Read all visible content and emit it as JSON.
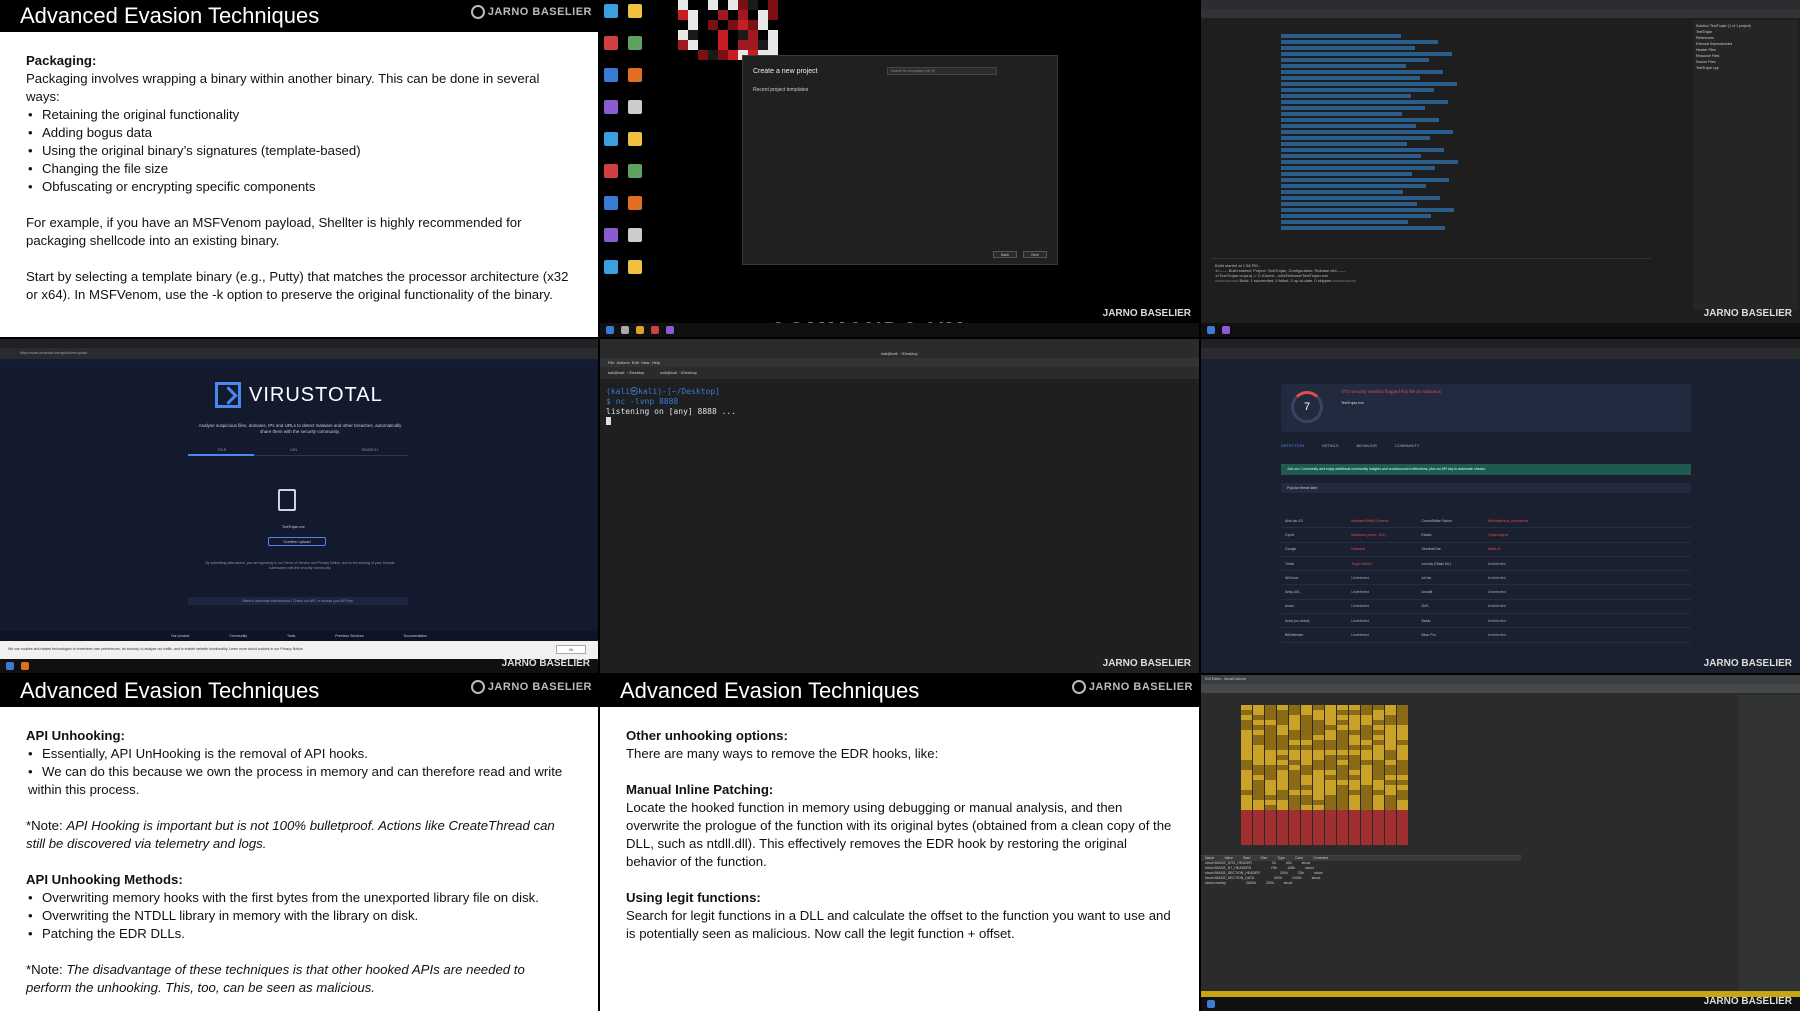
{
  "slides": {
    "packaging": {
      "title": "Advanced Evasion Techniques",
      "brand": "JARNO BASELIER",
      "heading": "Packaging:",
      "intro": "Packaging involves wrapping a binary within another binary. This can be done in several ways:",
      "bullets": [
        "Retaining the original functionality",
        "Adding bogus data",
        "Using the original binary’s signatures (template-based)",
        "Changing the file size",
        "Obfuscating or encrypting specific components"
      ],
      "para1": "For example, if you have an MSFVenom payload, Shellter is highly recommended for packaging shellcode into an existing binary.",
      "para2": "Start by selecting a template binary (e.g., Putty) that matches the processor architecture (x32 or x64). In MSFVenom, use the -k option to preserve the original functionality of the binary."
    },
    "api_unhooking": {
      "title": "Advanced Evasion Techniques",
      "brand": "JARNO BASELIER",
      "heading": "API Unhooking:",
      "bullets": [
        "Essentially, API UnHooking is the removal of API hooks.",
        "We can do this because we own the process in memory and can therefore read and write within this process."
      ],
      "note1_prefix": "*Note: ",
      "note1": "API Hooking is important but is not 100% bulletproof. Actions like CreateThread can still be discovered via telemetry and logs.",
      "methods_heading": "API Unhooking Methods:",
      "methods": [
        "Overwriting memory hooks with the first bytes from the unexported library file on disk.",
        "Overwriting the NTDLL library in memory with the library on disk.",
        "Patching the EDR DLLs."
      ],
      "note2_prefix": "*Note: ",
      "note2": "The disadvantage of these techniques is that other hooked APIs are needed to perform the unhooking. This, too, can be seen as malicious."
    },
    "other_unhooking": {
      "title": "Advanced Evasion Techniques",
      "brand": "JARNO BASELIER",
      "heading": "Other unhooking options:",
      "intro": "There are many ways to remove the EDR hooks, like:",
      "h2": "Manual Inline Patching:",
      "p2": "Locate the hooked function in memory using debugging or manual analysis, and then overwrite the prologue of the function with its original bytes (obtained from a clean copy of the DLL, such as ntdll.dll). This effectively removes the EDR hook by restoring the original behavior of the function.",
      "h3": "Using legit functions:",
      "p3": "Search for legit functions in a DLL and calculate the offset to the function you want to use and is potentially seen as malicious. Now call the legit function + offset."
    }
  },
  "commando": {
    "dialog_title": "Create a new project",
    "dialog_sub": "Recent project templates",
    "search_placeholder": "Search for templates (Alt+S)",
    "back_label": "Back",
    "next_label": "Next",
    "wallpaper_text": "COMMANDO VM",
    "watermark": "JARNO BASELIER"
  },
  "visual_studio": {
    "output": [
      "Build started at 1:58 PM...",
      "1>------ Build started: Project: TestTrojan, Configuration: Release x64 ------",
      "1>TestTrojan.vcxproj -> C:\\Users\\...\\x64\\Release\\TestTrojan.exe",
      "========== Build: 1 succeeded, 0 failed, 0 up-to-date, 0 skipped =========="
    ],
    "solution_items": [
      "Solution 'TestTrojan' (1 of 1 project)",
      "TestTrojan",
      "References",
      "External Dependencies",
      "Header Files",
      "Resource Files",
      "Source Files",
      "TestTrojan.cpp"
    ],
    "watermark": "JARNO BASELIER"
  },
  "virustotal_upload": {
    "url": "https://www.virustotal.com/gui/home/upload",
    "brand": "VIRUSTOTAL",
    "description": "Analyse suspicious files, domains, IPs and URLs to detect malware and other breaches, automatically share them with the security community.",
    "tabs": [
      "FILE",
      "URL",
      "SEARCH"
    ],
    "file_name": "TestTrojan.exe",
    "upload_button": "Confirm upload",
    "terms": "By submitting data above, you are agreeing to our Terms of Service and Privacy Notice, and to the sharing of your Sample submission with the security community.",
    "automate": "Want to automate submissions? Check our API, or access your API key.",
    "footer": [
      "Our product",
      "Community",
      "Tools",
      "Premium Services",
      "Documentation"
    ],
    "cookie_text": "We use cookies and related technologies to remember user preferences, for security, to analyse our traffic, and to enable website functionality. Learn more about cookies in our Privacy Notice.",
    "cookie_ok": "Ok",
    "watermark": "JARNO BASELIER"
  },
  "terminal": {
    "title": "kali@kali: ~/Desktop",
    "menu": [
      "File",
      "Actions",
      "Edit",
      "View",
      "Help"
    ],
    "tabs": [
      "kali@kali: ~/Desktop",
      "kali@kali: ~/Desktop"
    ],
    "prompt": "(kali㉿kali)-[~/Desktop]",
    "command": "$ nc -lvnp 8888",
    "output": "listening on [any] 8888 ...",
    "watermark": "JARNO BASELIER"
  },
  "virustotal_result": {
    "score": "7",
    "flag_text": "7/72 security vendors flagged this file as malicious",
    "file_name": "TestTrojan.exe",
    "tabs": [
      "DETECTION",
      "DETAILS",
      "BEHAVIOR",
      "COMMUNITY"
    ],
    "banner": "Join our Community and enjoy additional community insights and crowdsourced detections, plus an API key to automate checks.",
    "threat_label": "Popular threat label",
    "vendors": [
      [
        "AhnLab-V3",
        "Malware/Win64.Generic",
        "CrowdStrike Falcon",
        "Win/malicious_confidence"
      ],
      [
        "Cynet",
        "Malicious (score: 100)",
        "Elastic",
        "Trojan.Agent"
      ],
      [
        "Google",
        "Detected",
        "SentinelOne",
        "Static AI"
      ],
      [
        "Trellix",
        "Trojan.Win64",
        "Acronis (Static ML)",
        "Undetected"
      ],
      [
        "AliCloud",
        "Undetected",
        "ALYac",
        "Undetected"
      ],
      [
        "Antiy-AVL",
        "Undetected",
        "Arcabit",
        "Undetected"
      ],
      [
        "Avast",
        "Undetected",
        "AVG",
        "Undetected"
      ],
      [
        "Avira (no cloud)",
        "Undetected",
        "Baidu",
        "Undetected"
      ],
      [
        "BitDefender",
        "Undetected",
        "Bkav Pro",
        "Undetected"
      ]
    ],
    "watermark": "JARNO BASELIER"
  },
  "editor": {
    "title": "010 Editor - SmartCall.exe",
    "columns": [
      "Name",
      "Value",
      "Start",
      "Size",
      "Type",
      "Color",
      "Comment"
    ],
    "rows": [
      [
        "struct IMAGE_DOS_HEADER",
        "",
        "0h",
        "40h",
        "struct"
      ],
      [
        "struct IMAGE_NT_HEADERS",
        "",
        "F8h",
        "108h",
        "struct"
      ],
      [
        "struct IMAGE_SECTION_HEADER",
        "",
        "200h",
        "C8h",
        "struct"
      ],
      [
        "struct IMAGE_SECTION_DATA",
        "",
        "400h",
        "1000h",
        "struct"
      ],
      [
        "struct overlay",
        "",
        "2A00h",
        "200h",
        "struct"
      ]
    ],
    "watermark": "JARNO BASELIER"
  }
}
